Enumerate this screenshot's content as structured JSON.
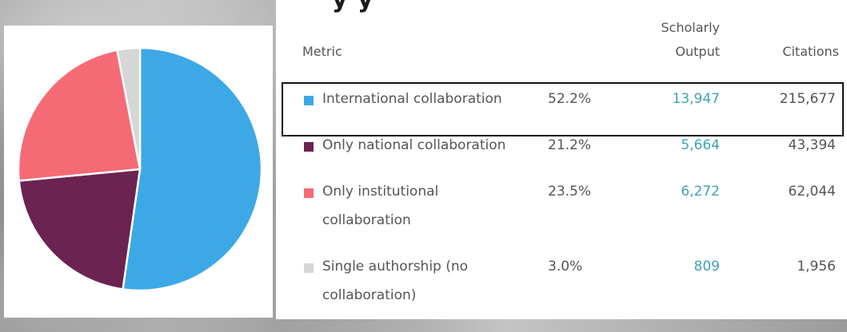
{
  "header": {
    "title_fragment": "y        y"
  },
  "chart_data": {
    "type": "pie",
    "slices": [
      {
        "label": "International collaboration",
        "percent": 52.2,
        "color": "#3ca9e6"
      },
      {
        "label": "Only national collaboration",
        "percent": 21.2,
        "color": "#6b2352"
      },
      {
        "label": "Only institutional collaboration",
        "percent": 23.5,
        "color": "#f56b75"
      },
      {
        "label": "Single authorship (no collaboration)",
        "percent": 3.0,
        "color": "#d6d6d6"
      }
    ]
  },
  "table": {
    "headers": {
      "metric": "Metric",
      "percent": "",
      "output_line1": "Scholarly",
      "output_line2": "Output",
      "citations": "Citations"
    },
    "rows": [
      {
        "metric_line1": "International collaboration",
        "metric_line2": "",
        "percent": "52.2%",
        "output": "13,947",
        "citations": "215,677",
        "color": "#3ca9e6"
      },
      {
        "metric_line1": "Only national collaboration",
        "metric_line2": "",
        "percent": "21.2%",
        "output": "5,664",
        "citations": "43,394",
        "color": "#6b2352"
      },
      {
        "metric_line1": "Only institutional",
        "metric_line2": "collaboration",
        "percent": "23.5%",
        "output": "6,272",
        "citations": "62,044",
        "color": "#f56b75"
      },
      {
        "metric_line1": "Single authorship (no",
        "metric_line2": "collaboration)",
        "percent": "3.0%",
        "output": "809",
        "citations": "1,956",
        "color": "#d6d6d6"
      }
    ]
  }
}
